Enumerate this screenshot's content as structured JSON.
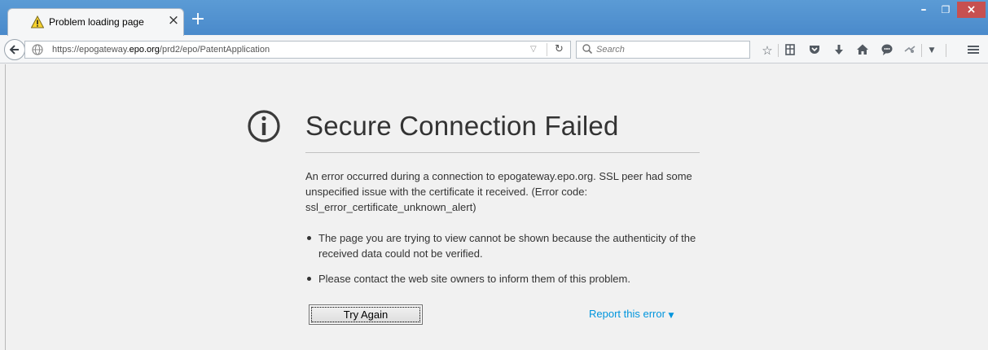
{
  "tab": {
    "title": "Problem loading page",
    "close_glyph": "×",
    "icon": "warning-icon"
  },
  "newtab": {
    "glyph": "+"
  },
  "window": {
    "minimize": "–",
    "maximize": "❐",
    "close": "×"
  },
  "navbar": {
    "url_prefix": "https://epogateway.",
    "url_domain": "epo.org",
    "url_path": "/prd2/epo/PatentApplication",
    "search_placeholder": "Search",
    "icons": [
      "bookmark-star-icon",
      "reading-list-icon",
      "pocket-icon",
      "download-icon",
      "home-icon",
      "chat-icon",
      "extension-icon",
      "menu-icon"
    ]
  },
  "error": {
    "title": "Secure Connection Failed",
    "description": "An error occurred during a connection to epogateway.epo.org. SSL peer had some unspecified issue with the certificate it received. (Error code: ssl_error_certificate_unknown_alert)",
    "bullets": [
      "The page you are trying to view cannot be shown because the authenticity of the received data could not be verified.",
      "Please contact the web site owners to inform them of this problem."
    ],
    "try_again": "Try Again",
    "report": "Report this error"
  },
  "colors": {
    "titlebar": "#4a8acb",
    "close_button": "#c75050",
    "link": "#0095dd"
  }
}
